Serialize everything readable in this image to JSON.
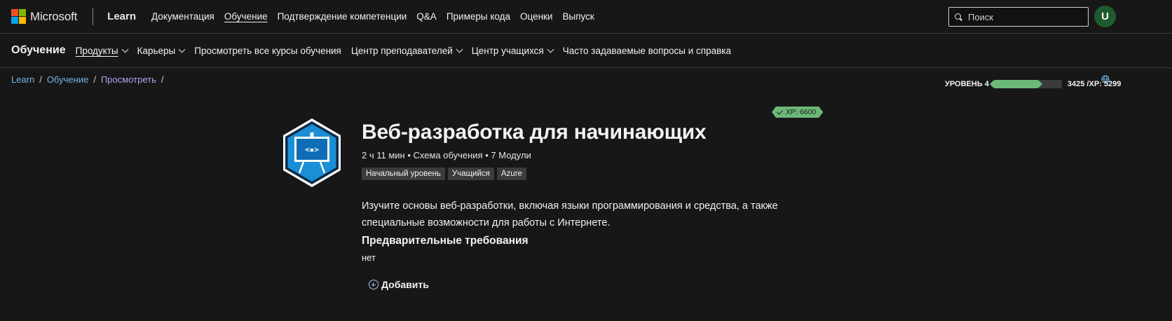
{
  "header": {
    "brand": "Microsoft",
    "product": "Learn",
    "nav": [
      {
        "label": "Документация"
      },
      {
        "label": "Обучение"
      },
      {
        "label": "Подтверждение компетенции"
      },
      {
        "label": "Q&A"
      },
      {
        "label": "Примеры кода"
      },
      {
        "label": "Оценки"
      },
      {
        "label": "Выпуск"
      }
    ],
    "search_placeholder": "Поиск",
    "avatar_initial": "U",
    "logo_colors": [
      "#f25022",
      "#7fba00",
      "#00a4ef",
      "#ffb900"
    ]
  },
  "subnav": {
    "title": "Обучение",
    "items": [
      {
        "label": "Продукты",
        "has_dropdown": true
      },
      {
        "label": "Карьеры",
        "has_dropdown": true
      },
      {
        "label": "Просмотреть все курсы обучения",
        "has_dropdown": false
      },
      {
        "label": "Центр преподавателей",
        "has_dropdown": true
      },
      {
        "label": "Центр учащихся",
        "has_dropdown": true
      },
      {
        "label": "Часто задаваемые вопросы и справка",
        "has_dropdown": false
      }
    ],
    "level_label": "УРОВЕНЬ 4",
    "level_progress": 0.65,
    "xp_text": "3425 /XP: 5299"
  },
  "breadcrumb": [
    {
      "label": "Learn"
    },
    {
      "label": "Обучение"
    },
    {
      "label": "Просмотреть"
    }
  ],
  "course": {
    "xp_badge": "XP: 6600",
    "title": "Веб-разработка для начинающих",
    "meta": "2 ч 11 мин • Схема обучения • 7 Модули",
    "tags": [
      "Начальный уровень",
      "Учащийся",
      "Azure"
    ],
    "description": "Изучите основы веб-разработки, включая языки программирования и средства, а также специальные возможности для работы с Интернете.",
    "prereq_heading": "Предварительные требования",
    "prereq_value": "нет",
    "add_label": "Добавить",
    "icon": "presentation-code-icon"
  },
  "colors": {
    "background": "#171717",
    "link": "#75b6e7",
    "visited_link": "#b99cf0",
    "xp_green": "#6cb878",
    "avatar_bg": "#1f5a2f"
  }
}
